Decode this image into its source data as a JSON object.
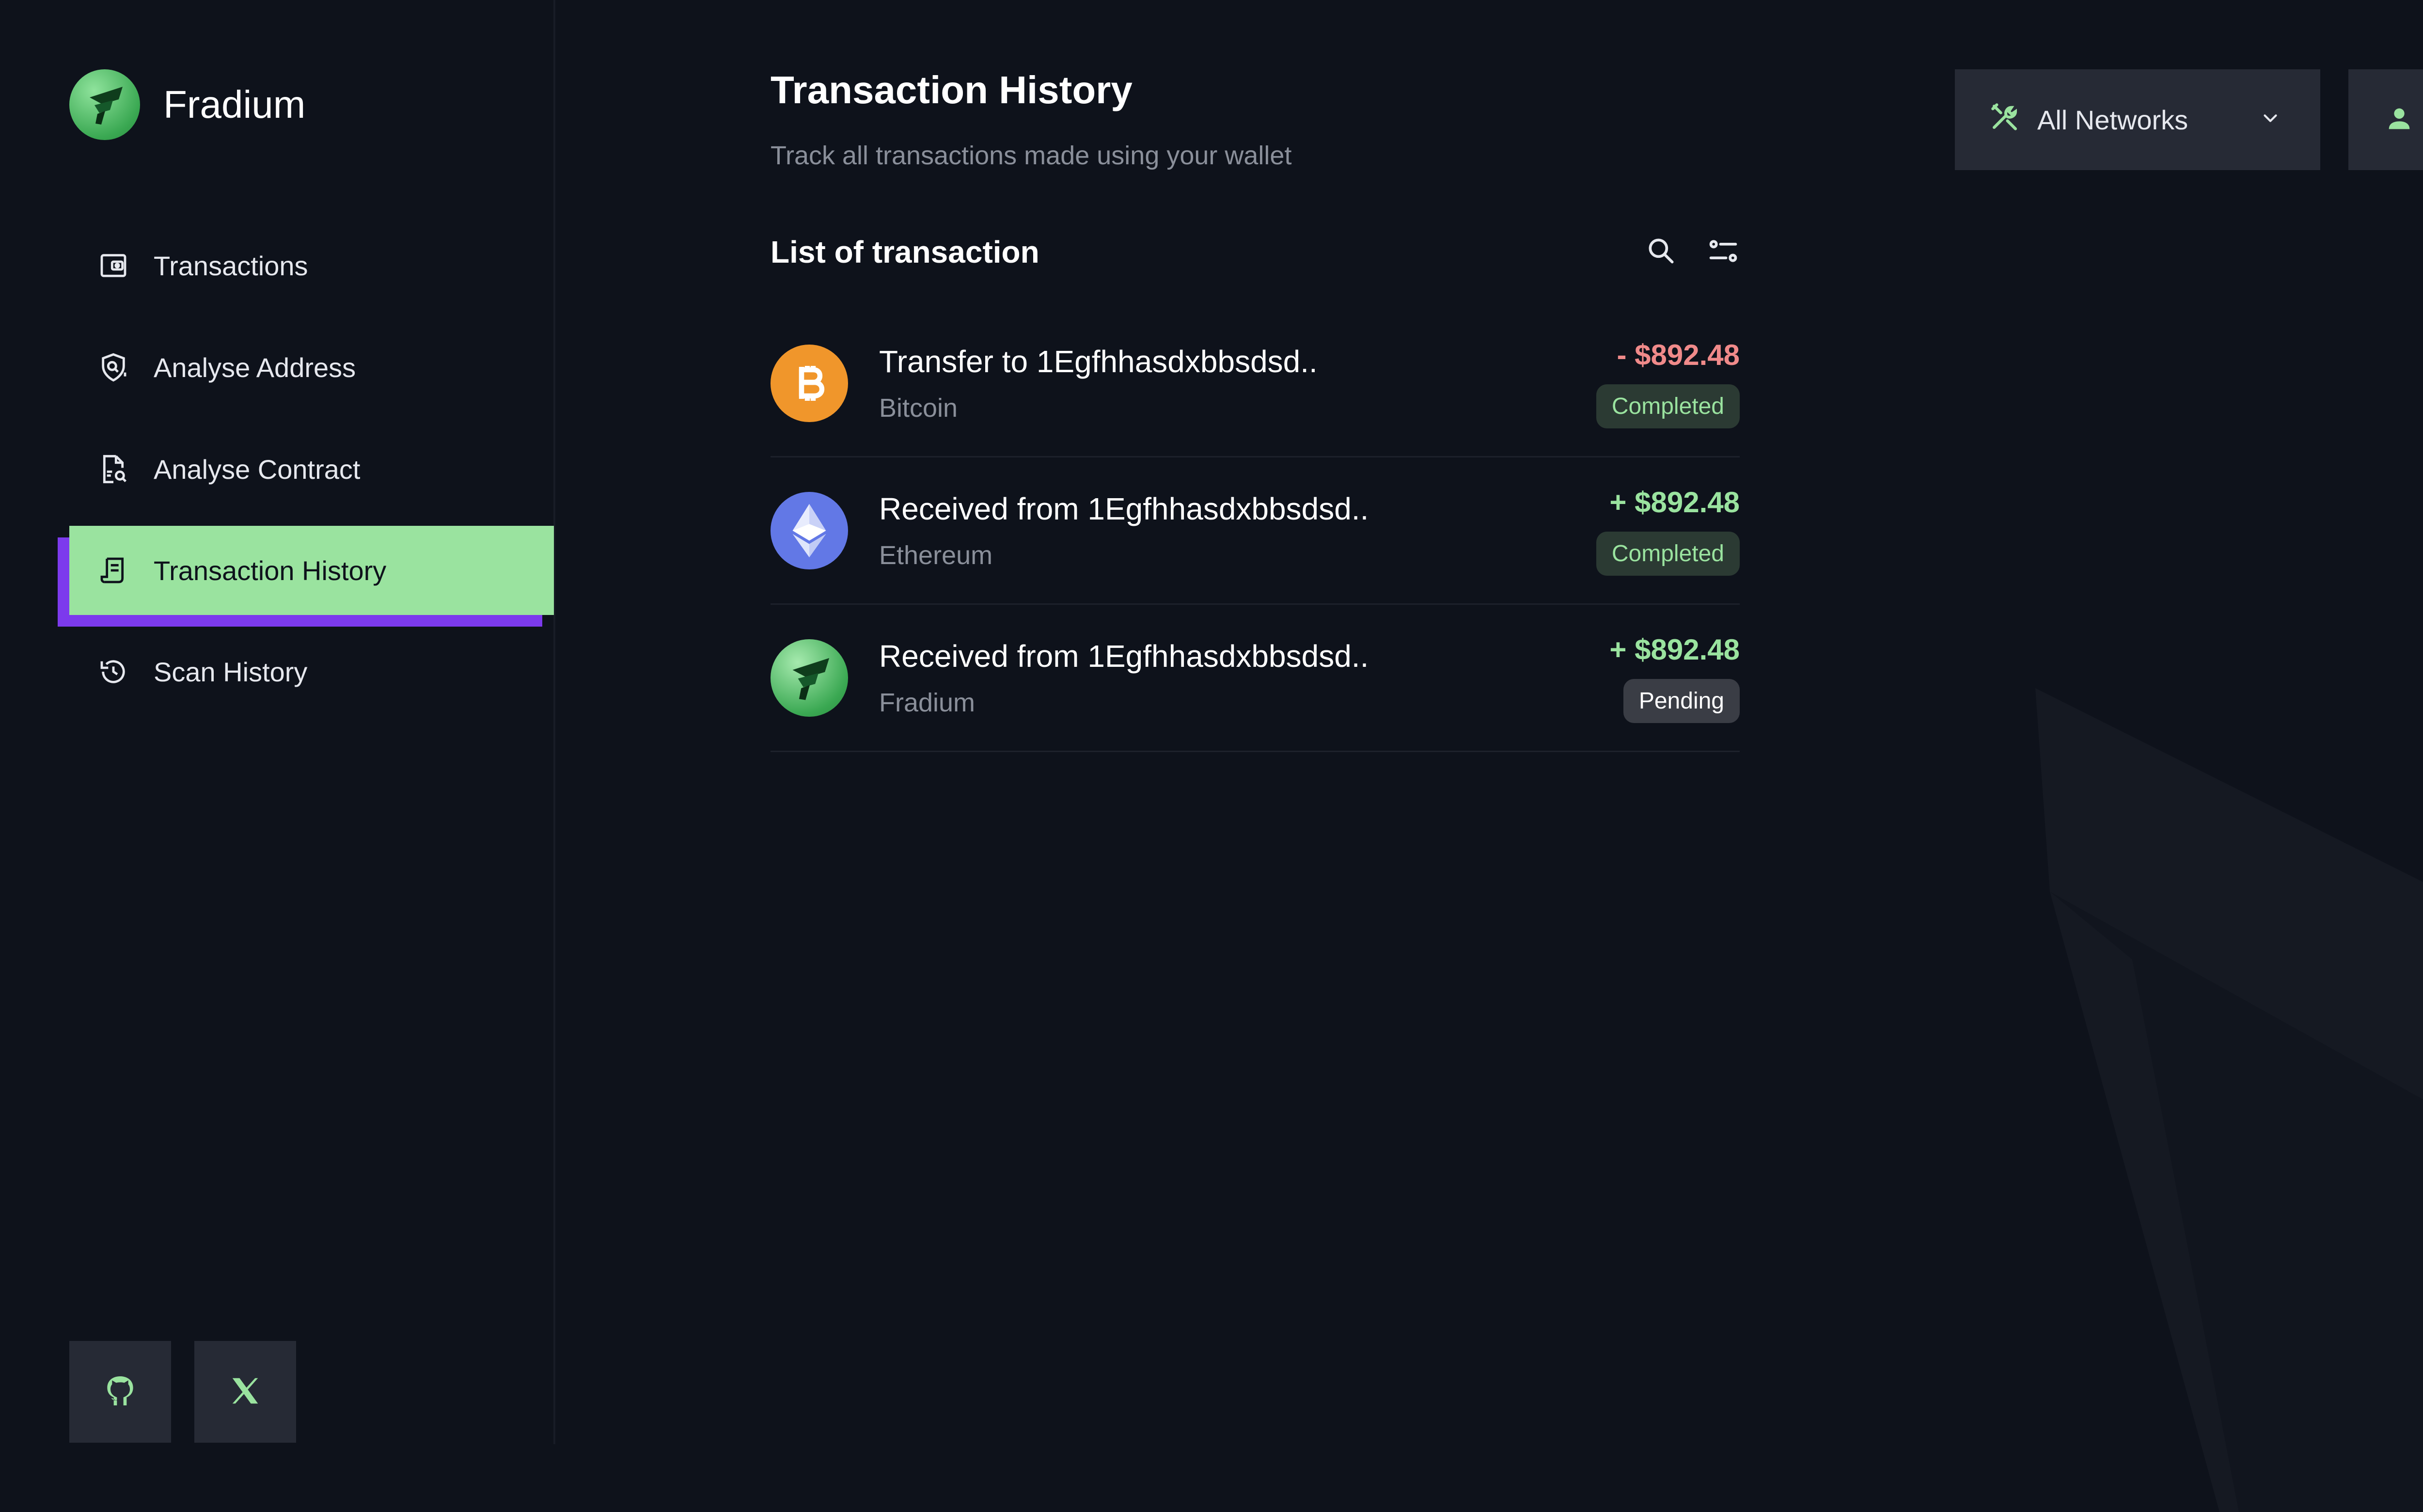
{
  "app": {
    "name": "Fradium"
  },
  "sidebar": {
    "items": [
      {
        "label": "Transactions",
        "icon": "wallet-icon",
        "active": false
      },
      {
        "label": "Analyse Address",
        "icon": "shield-search-icon",
        "active": false
      },
      {
        "label": "Analyse Contract",
        "icon": "document-search-icon",
        "active": false
      },
      {
        "label": "Transaction History",
        "icon": "receipt-icon",
        "active": true
      },
      {
        "label": "Scan History",
        "icon": "history-icon",
        "active": false
      }
    ],
    "social": [
      {
        "icon": "github-icon"
      },
      {
        "icon": "x-icon"
      }
    ]
  },
  "header": {
    "title": "Transaction History",
    "subtitle": "Track all transactions made using your wallet",
    "network_select": {
      "value": "All Networks",
      "icon": "tools-icon"
    },
    "user_icon": "user-icon"
  },
  "list": {
    "title": "List of transaction",
    "tools": [
      "search-icon",
      "filter-icon"
    ],
    "rows": [
      {
        "title": "Transfer to 1Egfhhasdxbbsdsd..",
        "network": "Bitcoin",
        "amount": "- $892.48",
        "status": "Completed",
        "icon": "bitcoin-icon"
      },
      {
        "title": "Received from 1Egfhhasdxbbsdsd..",
        "network": "Ethereum",
        "amount": "+ $892.48",
        "status": "Completed",
        "icon": "ethereum-icon"
      },
      {
        "title": "Received from 1Egfhhasdxbbsdsd..",
        "network": "Fradium",
        "amount": "+ $892.48",
        "status": "Pending",
        "icon": "fradium-icon"
      }
    ]
  },
  "colors": {
    "background": "#0e121b",
    "accent": "#9ae39f",
    "active_shadow": "#7c3aed",
    "negative": "#f08a8a",
    "muted": "#8a8f9a",
    "panel": "#262a35"
  }
}
